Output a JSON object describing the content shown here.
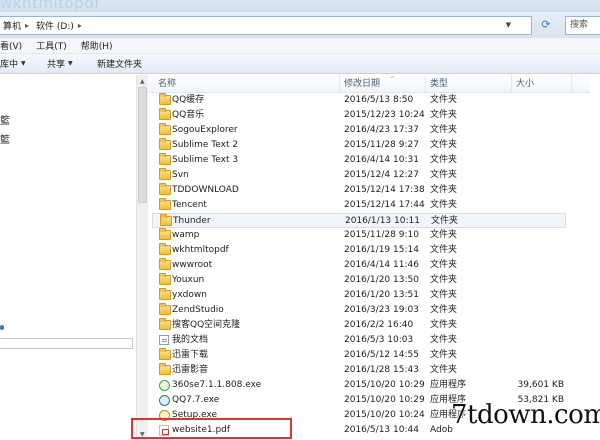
{
  "window": {
    "title_fragment": "wkhtmltopdf"
  },
  "address": {
    "crumb1": "算机",
    "crumb2": "软件 (D:)",
    "search_placeholder": "搜索"
  },
  "menu": [
    "看(V)",
    "工具(T)",
    "帮助(H)"
  ],
  "commands": {
    "organize": "库中",
    "share": "共享",
    "new_folder": "新建文件夹"
  },
  "nav": {
    "mark1": "籃",
    "mark2": "籃"
  },
  "columns": {
    "name": "名称",
    "date": "修改日期",
    "type": "类型",
    "size": "大小"
  },
  "rows": [
    {
      "name": "QQ缓存",
      "date": "2016/5/13 8:50",
      "type": "文件夹",
      "size": "",
      "icon": "folder"
    },
    {
      "name": "QQ音乐",
      "date": "2015/12/23 10:24",
      "type": "文件夹",
      "size": "",
      "icon": "folder"
    },
    {
      "name": "SogouExplorer",
      "date": "2016/4/23 17:37",
      "type": "文件夹",
      "size": "",
      "icon": "folder"
    },
    {
      "name": "Sublime Text 2",
      "date": "2015/11/28 9:27",
      "type": "文件夹",
      "size": "",
      "icon": "folder"
    },
    {
      "name": "Sublime Text 3",
      "date": "2016/4/14 10:31",
      "type": "文件夹",
      "size": "",
      "icon": "folder"
    },
    {
      "name": "Svn",
      "date": "2015/12/4 12:27",
      "type": "文件夹",
      "size": "",
      "icon": "folder"
    },
    {
      "name": "TDDOWNLOAD",
      "date": "2015/12/14 17:38",
      "type": "文件夹",
      "size": "",
      "icon": "folder"
    },
    {
      "name": "Tencent",
      "date": "2015/12/14 17:44",
      "type": "文件夹",
      "size": "",
      "icon": "folder"
    },
    {
      "name": "Thunder",
      "date": "2016/1/13 10:11",
      "type": "文件夹",
      "size": "",
      "icon": "folder",
      "selected": true
    },
    {
      "name": "wamp",
      "date": "2015/11/28 9:10",
      "type": "文件夹",
      "size": "",
      "icon": "folder"
    },
    {
      "name": "wkhtmltopdf",
      "date": "2016/1/19 15:14",
      "type": "文件夹",
      "size": "",
      "icon": "folder"
    },
    {
      "name": "wwwroot",
      "date": "2016/4/14 11:46",
      "type": "文件夹",
      "size": "",
      "icon": "folder"
    },
    {
      "name": "Youxun",
      "date": "2016/1/20 13:50",
      "type": "文件夹",
      "size": "",
      "icon": "folder"
    },
    {
      "name": "yxdown",
      "date": "2016/1/20 13:51",
      "type": "文件夹",
      "size": "",
      "icon": "folder"
    },
    {
      "name": "ZendStudio",
      "date": "2016/3/23 19:03",
      "type": "文件夹",
      "size": "",
      "icon": "folder"
    },
    {
      "name": "搜客QQ空间克隆",
      "date": "2016/2/2 16:40",
      "type": "文件夹",
      "size": "",
      "icon": "folder"
    },
    {
      "name": "我的文档",
      "date": "2016/5/3 10:03",
      "type": "文件夹",
      "size": "",
      "icon": "docfolder"
    },
    {
      "name": "迅雷下载",
      "date": "2016/5/12 14:55",
      "type": "文件夹",
      "size": "",
      "icon": "folder"
    },
    {
      "name": "迅雷影音",
      "date": "2016/1/28 15:43",
      "type": "文件夹",
      "size": "",
      "icon": "folder"
    },
    {
      "name": "360se7.1.1.808.exe",
      "date": "2015/10/20 10:29",
      "type": "应用程序",
      "size": "39,601 KB",
      "icon": "exe"
    },
    {
      "name": "QQ7.7.exe",
      "date": "2015/10/20 10:29",
      "type": "应用程序",
      "size": "53,821 KB",
      "icon": "exe-qq"
    },
    {
      "name": "Setup.exe",
      "date": "2015/10/20 10:24",
      "type": "应用程序",
      "size": "",
      "icon": "exe-setup"
    },
    {
      "name": "website1.pdf",
      "date": "2016/5/13 10:44",
      "type": "Adob",
      "size": "",
      "icon": "pdf"
    }
  ],
  "watermark": "7tdown.com"
}
